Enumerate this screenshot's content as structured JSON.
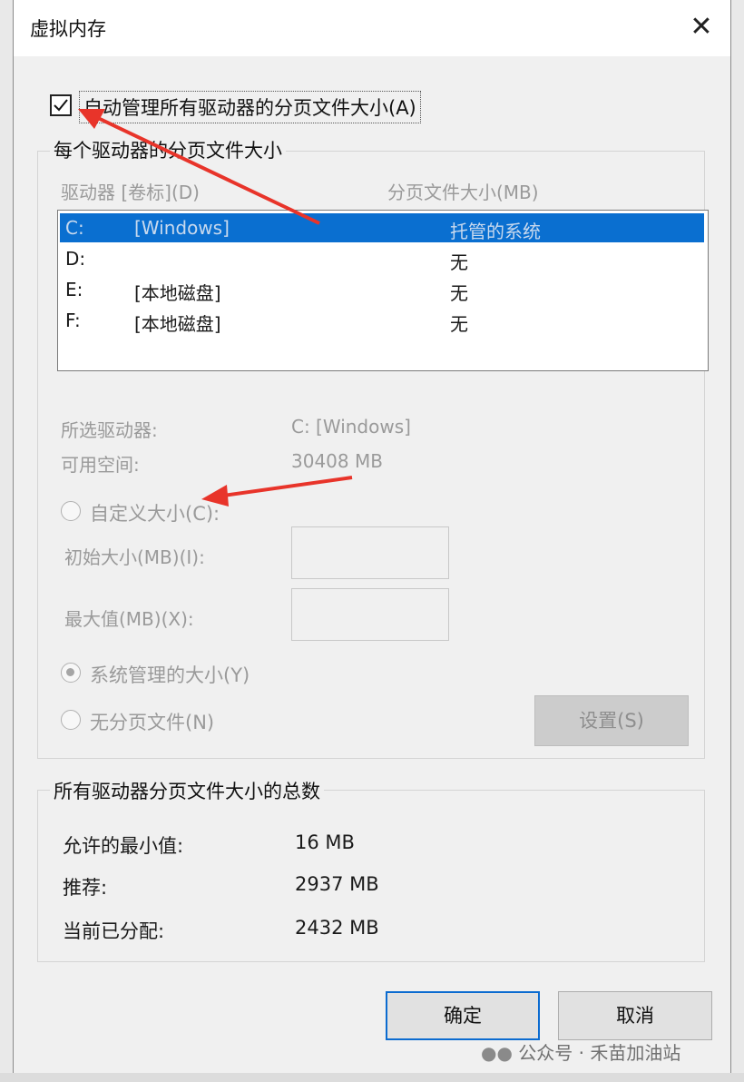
{
  "dialog": {
    "title": "虚拟内存",
    "close_glyph": "✕"
  },
  "auto_manage": {
    "checked": true,
    "label": "自动管理所有驱动器的分页文件大小(A)"
  },
  "per_drive": {
    "group_title": "每个驱动器的分页文件大小",
    "col_drive": "驱动器 [卷标](D)",
    "col_size": "分页文件大小(MB)",
    "rows": [
      {
        "drive": "C:",
        "label": "[Windows]",
        "size": "托管的系统",
        "selected": true
      },
      {
        "drive": "D:",
        "label": "",
        "size": "无",
        "selected": false
      },
      {
        "drive": "E:",
        "label": "[本地磁盘]",
        "size": "无",
        "selected": false
      },
      {
        "drive": "F:",
        "label": "[本地磁盘]",
        "size": "无",
        "selected": false
      }
    ],
    "selected_drive_label": "所选驱动器:",
    "selected_drive_value": "C:  [Windows]",
    "free_space_label": "可用空间:",
    "free_space_value": "30408 MB",
    "custom_size_label": "自定义大小(C):",
    "initial_size_label": "初始大小(MB)(I):",
    "max_size_label": "最大值(MB)(X):",
    "system_managed_label": "系统管理的大小(Y)",
    "no_paging_label": "无分页文件(N)",
    "set_button": "设置(S)"
  },
  "totals": {
    "group_title": "所有驱动器分页文件大小的总数",
    "min_label": "允许的最小值:",
    "min_value": "16 MB",
    "recommended_label": "推荐:",
    "recommended_value": "2937 MB",
    "current_label": "当前已分配:",
    "current_value": "2432 MB"
  },
  "buttons": {
    "ok": "确定",
    "cancel": "取消"
  },
  "watermark": "公众号 · 禾苗加油站",
  "colors": {
    "selection": "#0a6fd0",
    "annotation_arrow": "#e8342a",
    "ok_border": "#0b6bd0"
  }
}
